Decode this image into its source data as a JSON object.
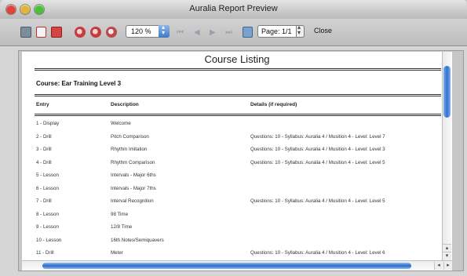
{
  "window": {
    "title": "Auralia Report Preview"
  },
  "toolbar": {
    "zoom": "120 %",
    "page": "Page: 1/1",
    "close_label": "Close",
    "nav": {
      "first": "⏮",
      "prev": "◀",
      "next": "▶",
      "last": "⏭"
    }
  },
  "report": {
    "title": "Course Listing",
    "course": "Course: Ear Training Level 3",
    "columns": {
      "entry": "Entry",
      "description": "Description",
      "details": "Details (if required)"
    },
    "rows": [
      {
        "entry": "1 - Display",
        "description": "Welcome",
        "details": ""
      },
      {
        "entry": "2 - Drill",
        "description": "Pitch Comparison",
        "details": "Questions: 10 -  Syllabus: Auralia 4 / Musition 4 - Level: Level 7"
      },
      {
        "entry": "3 - Drill",
        "description": "Rhythm Imitation",
        "details": "Questions: 10 -  Syllabus: Auralia 4 / Musition 4 - Level: Level 3"
      },
      {
        "entry": "4 - Drill",
        "description": "Rhythm Comparison",
        "details": "Questions: 10 -  Syllabus: Auralia 4 / Musition 4 - Level: Level 5"
      },
      {
        "entry": "5 - Lesson",
        "description": "Intervals - Major 6ths",
        "details": ""
      },
      {
        "entry": "6 - Lesson",
        "description": "Intervals - Major 7ths",
        "details": ""
      },
      {
        "entry": "7 - Drill",
        "description": "Interval Recognition",
        "details": "Questions: 10 -  Syllabus: Auralia 4 / Musition 4 - Level: Level 5"
      },
      {
        "entry": "8 - Lesson",
        "description": "98 Time",
        "details": ""
      },
      {
        "entry": "9 - Lesson",
        "description": "12/8 Time",
        "details": ""
      },
      {
        "entry": "10 - Lesson",
        "description": "16th Notes/Semiquavers",
        "details": ""
      },
      {
        "entry": "11 - Drill",
        "description": "Meter",
        "details": "Questions: 10 -  Syllabus: Auralia 4 / Musition 4 - Level: Level 6"
      }
    ]
  },
  "scroll": {
    "up": "▴",
    "down": "▾",
    "left": "◂",
    "right": "▸"
  }
}
